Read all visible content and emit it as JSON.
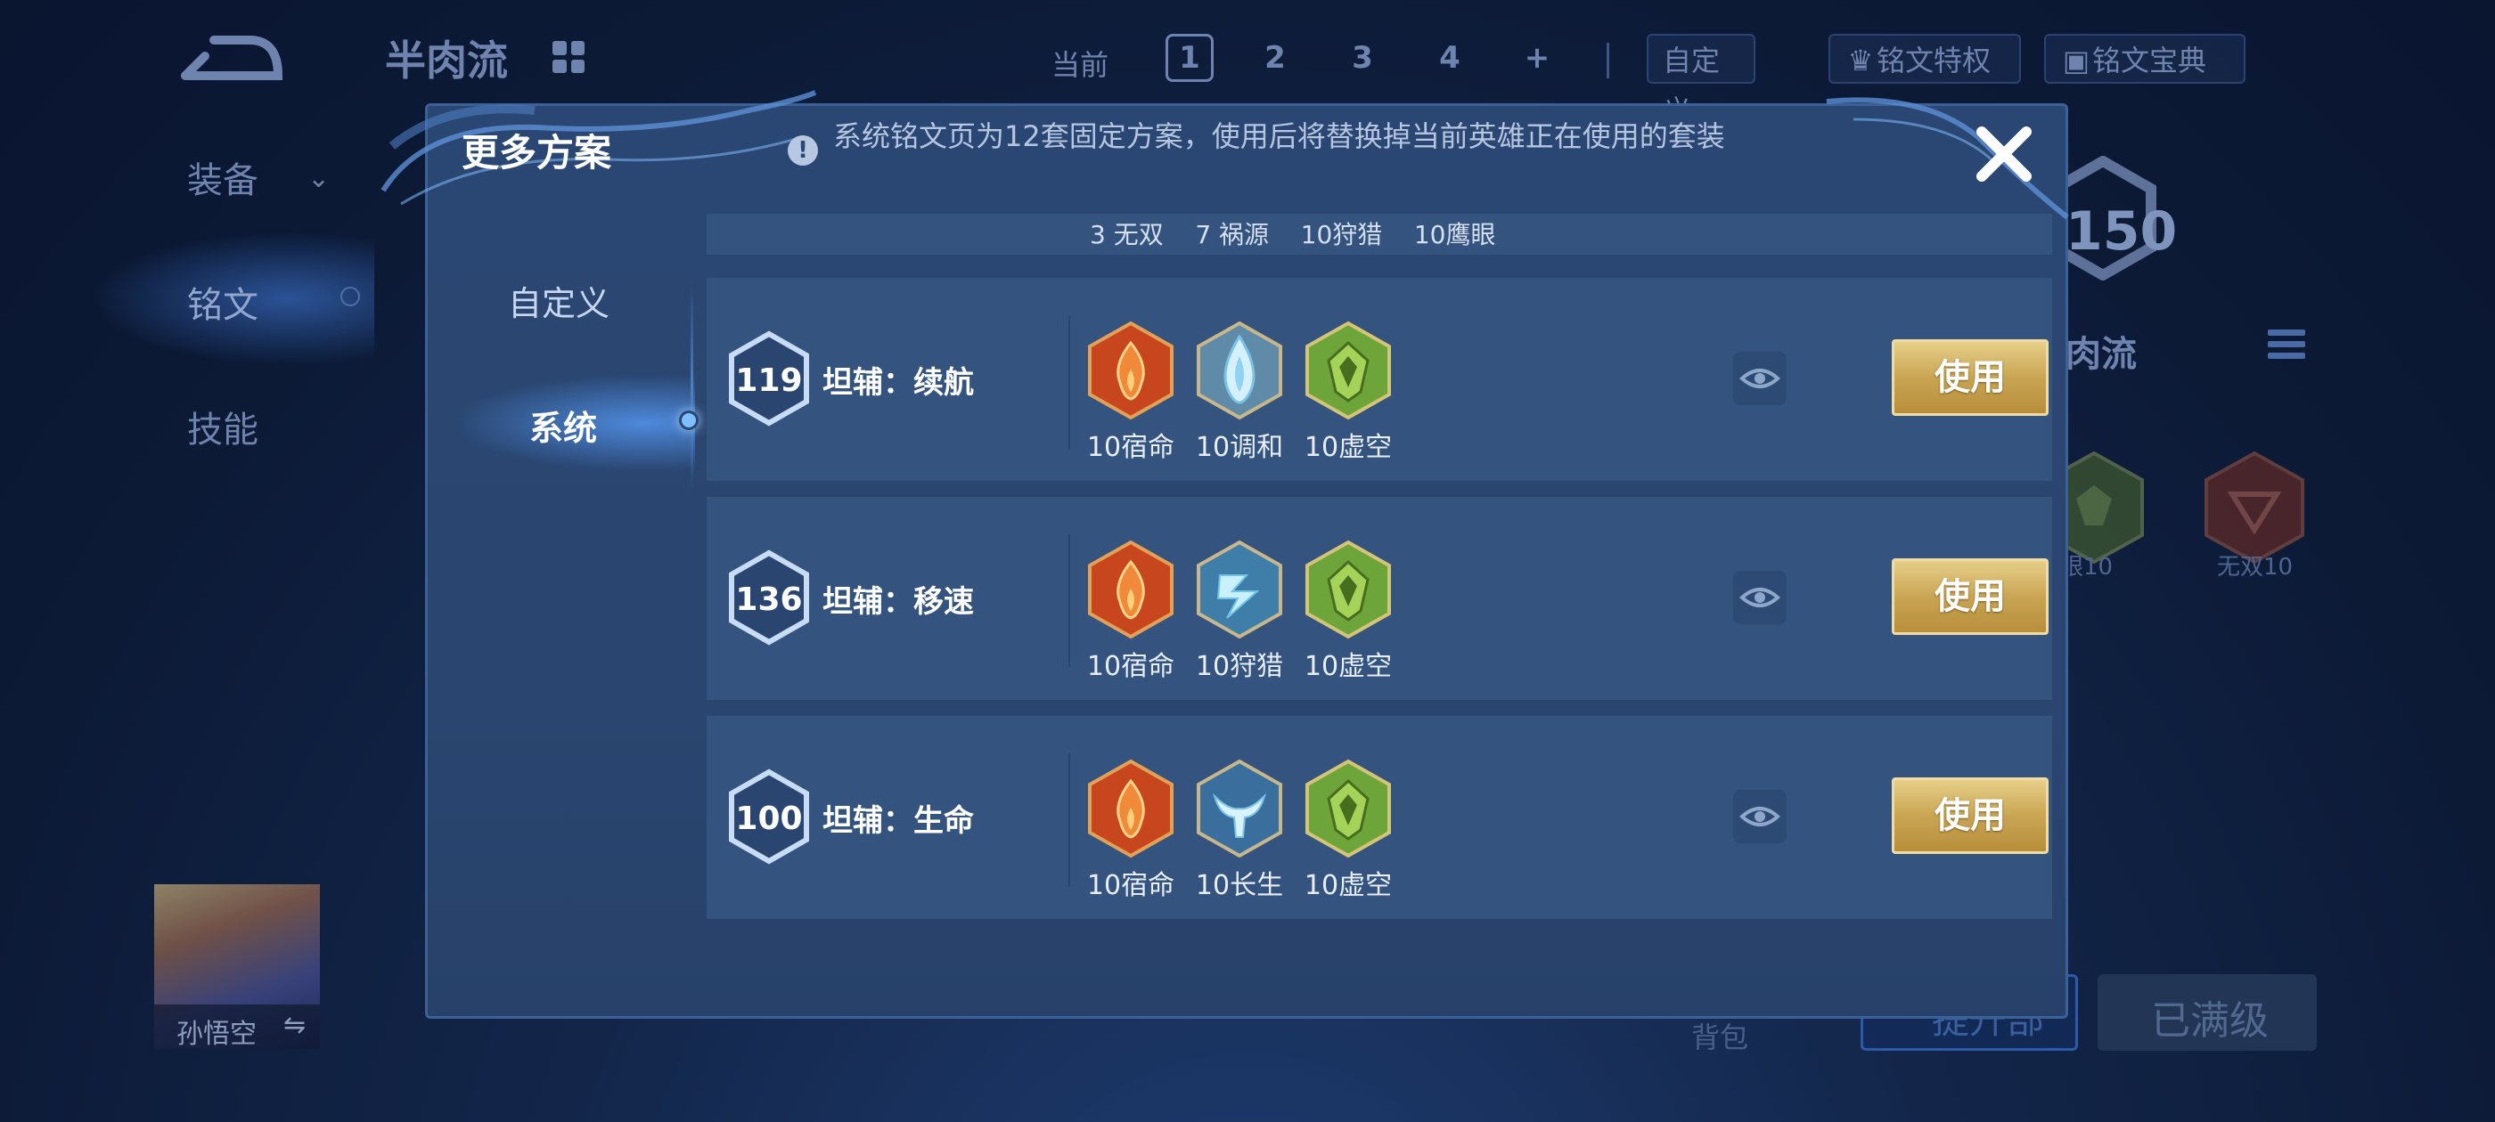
{
  "background": {
    "plan_title": "半肉流",
    "side_nav": [
      "装备",
      "铭文",
      "技能"
    ],
    "current_label": "当前",
    "pages": [
      "1",
      "2",
      "3",
      "4",
      "+"
    ],
    "custom_button": "自定义",
    "rune_privilege_button": "铭文特权",
    "rune_codex_button": "铭文宝典",
    "level_value": "150",
    "hero_plan_name": "肉流",
    "rune_mini": [
      {
        "label": "眼10",
        "color": "#6f8a3c"
      },
      {
        "label": "无双10",
        "color": "#9c3d2c"
      }
    ],
    "hero_name": "孙悟空",
    "backpack_label": "背包",
    "bottom_blue_button": "提升部",
    "maxed_button": "已满级"
  },
  "modal": {
    "title": "更多方案",
    "notice": "系统铭文页为12套固定方案，使用后将替换掉当前英雄正在使用的套装",
    "tabs": [
      {
        "label": "自定义",
        "active": false
      },
      {
        "label": "系统",
        "active": true
      }
    ],
    "partial_card_runes": "3 无双    7 祸源    10狩猎    10鹰眼",
    "plans": [
      {
        "level": "119",
        "name": "坦辅：续航",
        "runes": [
          {
            "label": "10宿命",
            "icon": "red-fire-rune-icon",
            "color": "#c8461e"
          },
          {
            "label": "10调和",
            "icon": "blue-drop-rune-icon",
            "color": "#4b90b8"
          },
          {
            "label": "10虚空",
            "icon": "green-rune-icon",
            "color": "#6ea53a"
          }
        ],
        "use_label": "使用"
      },
      {
        "level": "136",
        "name": "坦辅：移速",
        "runes": [
          {
            "label": "10宿命",
            "icon": "red-fire-rune-icon",
            "color": "#c8461e"
          },
          {
            "label": "10狩猎",
            "icon": "blue-lightning-rune-icon",
            "color": "#3f7ea8"
          },
          {
            "label": "10虚空",
            "icon": "green-rune-icon",
            "color": "#6ea53a"
          }
        ],
        "use_label": "使用"
      },
      {
        "level": "100",
        "name": "坦辅：生命",
        "runes": [
          {
            "label": "10宿命",
            "icon": "red-fire-rune-icon",
            "color": "#c8461e"
          },
          {
            "label": "10长生",
            "icon": "blue-tail-rune-icon",
            "color": "#3a6e9c"
          },
          {
            "label": "10虚空",
            "icon": "green-rune-icon",
            "color": "#6ea53a"
          }
        ],
        "use_label": "使用"
      }
    ]
  },
  "colors": {
    "use_button_gold": "#c9a553",
    "modal_bg": "#2a4672",
    "card_bg": "#34547f",
    "accent_glow": "#7ec0ff"
  }
}
